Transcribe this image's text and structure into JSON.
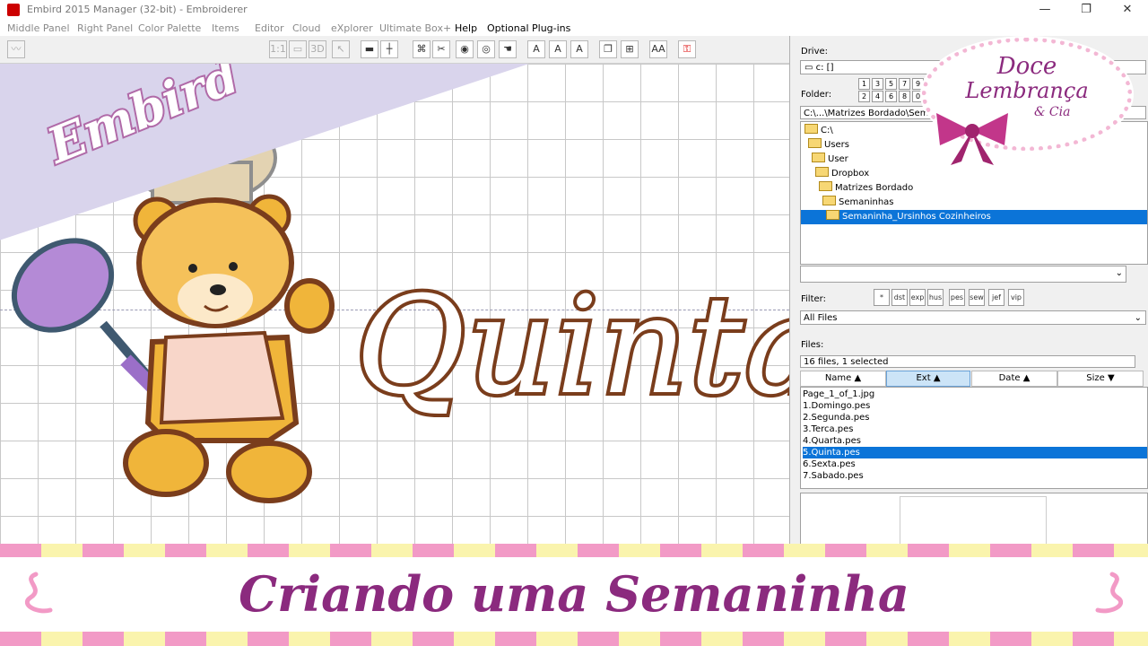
{
  "window": {
    "title": "Embird 2015 Manager (32-bit) - Embroiderer",
    "minimize": "—",
    "maximize": "❐",
    "close": "✕"
  },
  "menu": [
    "Middle Panel",
    "Right Panel",
    "Color Palette",
    "Items",
    "Editor",
    "Cloud",
    "eXplorer",
    "Ultimate Box+",
    "Help",
    "Optional Plug-ins"
  ],
  "toolbar": [
    "1:1",
    "3D",
    "A",
    "A",
    "A",
    "AA"
  ],
  "overlay": {
    "embird_tag": "Embird",
    "design_text": "Quinta"
  },
  "right_panel": {
    "drive_label": "Drive:",
    "drive_value": "c: []",
    "folder_label": "Folder:",
    "folder_path": "C:\\...\\Matrizes Bordado\\Semaninhas",
    "folder_buttons_row1": [
      "1",
      "3",
      "5",
      "7",
      "9"
    ],
    "folder_buttons_row2": [
      "2",
      "4",
      "6",
      "8",
      "0"
    ],
    "tree": [
      {
        "label": "C:\\",
        "indent": 0
      },
      {
        "label": "Users",
        "indent": 1
      },
      {
        "label": "User",
        "indent": 2
      },
      {
        "label": "Dropbox",
        "indent": 3
      },
      {
        "label": "Matrizes Bordado",
        "indent": 4
      },
      {
        "label": "Semaninhas",
        "indent": 5
      },
      {
        "label": "Semaninha_Ursinhos Cozinheiros",
        "indent": 6,
        "selected": true
      }
    ],
    "filter_label": "Filter:",
    "filter_exts": [
      "*",
      "dst",
      "exp",
      "hus",
      "pes",
      "sew",
      "jef",
      "vip"
    ],
    "all_files": "All Files",
    "files_label": "Files:",
    "files_status": "16 files, 1 selected",
    "columns": [
      "Name ▲",
      "Ext ▲",
      "Date ▲",
      "Size ▼"
    ],
    "files": [
      {
        "name": "Page_1_of_1.jpg"
      },
      {
        "name": "1.Domingo.pes"
      },
      {
        "name": "2.Segunda.pes"
      },
      {
        "name": "3.Terca.pes"
      },
      {
        "name": "4.Quarta.pes"
      },
      {
        "name": "5.Quinta.pes",
        "selected": true
      },
      {
        "name": "6.Sexta.pes"
      },
      {
        "name": "7.Sabado.pes"
      }
    ]
  },
  "brand": {
    "line1": "Doce",
    "line2": "Lembrança",
    "line3": "& Cia"
  },
  "footer": {
    "title": "Criando uma Semaninha"
  }
}
